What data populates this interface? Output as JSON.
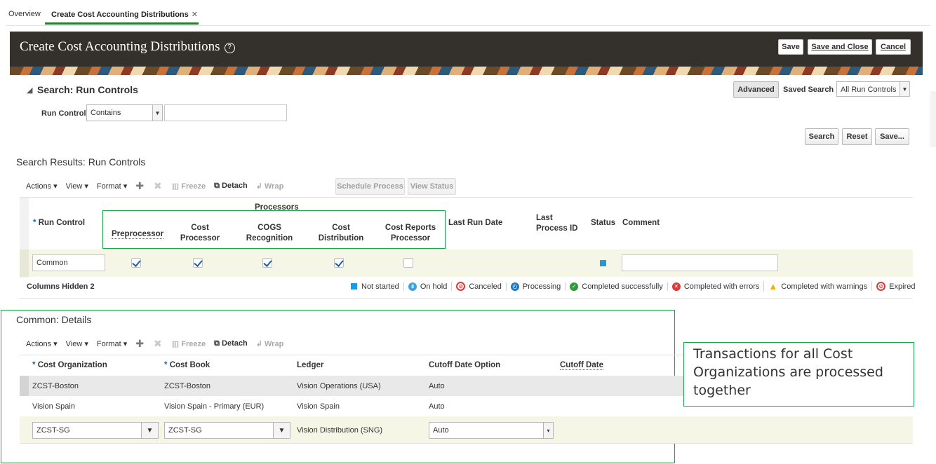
{
  "tabs": [
    "Overview",
    "Create Cost Accounting Distributions"
  ],
  "header": {
    "title": "Create Cost Accounting Distributions",
    "save": "Save",
    "save_close": "Save and Close",
    "cancel": "Cancel"
  },
  "search": {
    "title": "Search: Run Controls",
    "advanced": "Advanced",
    "saved_search_label": "Saved Search",
    "saved_search_value": "All Run Controls",
    "run_control_label": "Run Control",
    "operator": "Contains",
    "value": "",
    "search_btn": "Search",
    "reset_btn": "Reset",
    "save_btn": "Save..."
  },
  "results": {
    "title": "Search Results: Run Controls",
    "toolbar": {
      "actions": "Actions",
      "view": "View",
      "format": "Format",
      "freeze": "Freeze",
      "detach": "Detach",
      "wrap": "Wrap",
      "schedule": "Schedule Process",
      "view_status": "View Status"
    },
    "headers": {
      "run_control": "Run Control",
      "processors": "Processors",
      "preprocessor": "Preprocessor",
      "cost_processor_1": "Cost",
      "cost_processor_2": "Processor",
      "cogs_1": "COGS",
      "cogs_2": "Recognition",
      "dist_1": "Cost",
      "dist_2": "Distribution",
      "reports_1": "Cost Reports",
      "reports_2": "Processor",
      "last_run": "Last Run Date",
      "last_process_1": "Last",
      "last_process_2": "Process ID",
      "status": "Status",
      "comment": "Comment"
    },
    "row": {
      "run_control": "Common",
      "preprocessor": true,
      "cost_processor": true,
      "cogs": true,
      "distribution": true,
      "reports": false,
      "comment": ""
    },
    "columns_hidden_label": "Columns Hidden",
    "columns_hidden_count": "2",
    "legend": [
      {
        "label": "Not started",
        "color": "#1e9ae0",
        "icon": "square-icon"
      },
      {
        "label": "On hold",
        "color": "#3fa0e0",
        "icon": "pause-icon"
      },
      {
        "label": "Canceled",
        "color": "#d83a3a",
        "icon": "cancel-icon"
      },
      {
        "label": "Processing",
        "color": "#1e7ac0",
        "icon": "clock-icon"
      },
      {
        "label": "Completed successfully",
        "color": "#2e9a3a",
        "icon": "check-icon"
      },
      {
        "label": "Completed with errors",
        "color": "#d83a3a",
        "icon": "error-icon"
      },
      {
        "label": "Completed with warnings",
        "color": "#f0b000",
        "icon": "warning-icon"
      },
      {
        "label": "Expired",
        "color": "#d83a3a",
        "icon": "expired-icon"
      }
    ]
  },
  "details": {
    "title": "Common: Details",
    "toolbar": {
      "actions": "Actions",
      "view": "View",
      "format": "Format",
      "freeze": "Freeze",
      "detach": "Detach",
      "wrap": "Wrap"
    },
    "headers": {
      "cost_org": "Cost Organization",
      "cost_book": "Cost Book",
      "ledger": "Ledger",
      "cutoff_option": "Cutoff Date Option",
      "cutoff_date": "Cutoff Date"
    },
    "rows": [
      {
        "cost_org": "ZCST-Boston",
        "cost_book": "ZCST-Boston",
        "ledger": "Vision Operations (USA)",
        "cutoff_option": "Auto"
      },
      {
        "cost_org": "Vision Spain",
        "cost_book": "Vision Spain - Primary (EUR)",
        "ledger": "Vision Spain",
        "cutoff_option": "Auto"
      },
      {
        "cost_org": "ZCST-SG",
        "cost_book": "ZCST-SG",
        "ledger": "Vision Distribution (SNG)",
        "cutoff_option": "Auto"
      }
    ]
  },
  "callout": {
    "line1": "Transactions for all Cost",
    "line2": "Organizations are processed",
    "line3": "together"
  }
}
